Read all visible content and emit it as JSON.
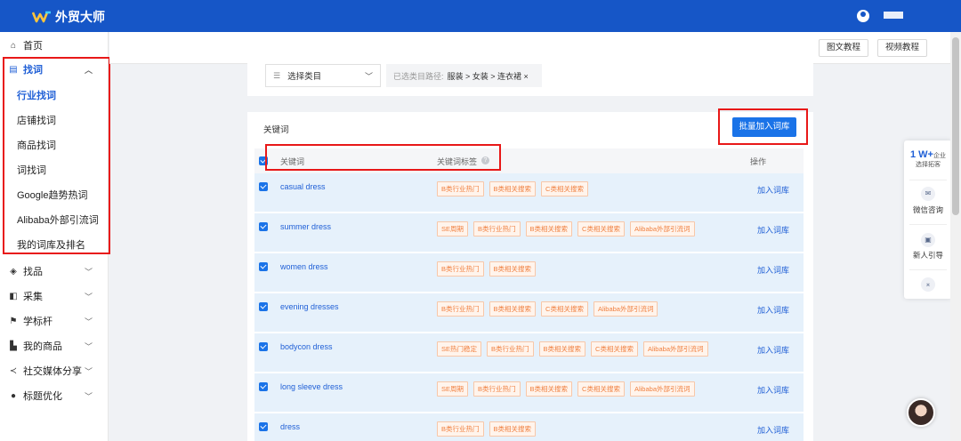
{
  "app": {
    "logo_text": "外贸大师"
  },
  "header_buttons": {
    "graphic_tutorial": "图文教程",
    "video_tutorial": "视频教程"
  },
  "sidebar": {
    "home": "首页",
    "find_words": "找词",
    "sub_items": [
      "行业找词",
      "店铺找词",
      "商品找词",
      "词找词",
      "Google趋势热词",
      "Alibaba外部引流词",
      "我的词库及排名"
    ],
    "find_products": "找品",
    "collect": "采集",
    "benchmark": "学标杆",
    "my_products": "我的商品",
    "social_share": "社交媒体分享",
    "title_optimize": "标题优化"
  },
  "category": {
    "select_label": "选择类目",
    "path_label": "已选类目路径:",
    "path_value": "服装 > 女装 > 连衣裙 ×"
  },
  "keywords": {
    "title": "关键词",
    "batch_button": "批量加入词库",
    "col_keyword": "关键词",
    "col_tags": "关键词标签",
    "col_action": "操作",
    "add_label": "加入词库",
    "rows": [
      {
        "keyword": "casual dress",
        "tags": [
          "B类行业热门",
          "B类相关搜索",
          "C类相关搜索"
        ]
      },
      {
        "keyword": "summer dress",
        "tags": [
          "SE周期",
          "B类行业热门",
          "B类相关搜索",
          "C类相关搜索",
          "Alibaba外部引流词"
        ]
      },
      {
        "keyword": "women dress",
        "tags": [
          "B类行业热门",
          "B类相关搜索"
        ]
      },
      {
        "keyword": "evening dresses",
        "tags": [
          "B类行业热门",
          "B类相关搜索",
          "C类相关搜索",
          "Alibaba外部引流词"
        ]
      },
      {
        "keyword": "bodycon dress",
        "tags": [
          "SE热门稳定",
          "B类行业热门",
          "B类相关搜索",
          "C类相关搜索",
          "Alibaba外部引流词"
        ]
      },
      {
        "keyword": "long sleeve dress",
        "tags": [
          "SE周期",
          "B类行业热门",
          "B类相关搜索",
          "C类相关搜索",
          "Alibaba外部引流词"
        ]
      },
      {
        "keyword": "dress",
        "tags": [
          "B类行业热门",
          "B类相关搜索"
        ]
      }
    ]
  },
  "float_panel": {
    "count": "1 W+",
    "count_unit": "企业",
    "count_sub": "选择拓客",
    "wechat": "微信咨询",
    "guide": "新人引导"
  },
  "colors": {
    "brand": "#1656c7",
    "accent": "#1a73e8",
    "highlight_border": "#e81818",
    "tag_text": "#f08040"
  }
}
